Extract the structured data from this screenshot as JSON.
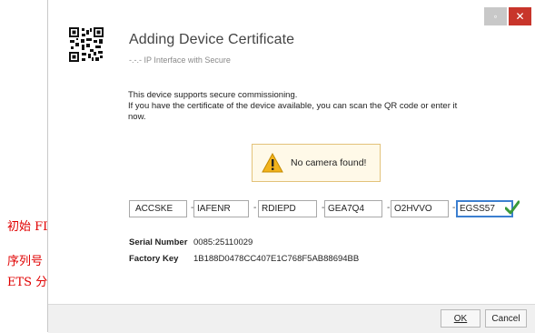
{
  "dialog": {
    "title": "Adding Device Certificate",
    "subtitle": "-.-.- IP Interface with Secure",
    "info_line1": "This device supports secure commissioning.",
    "info_line2": "If you have the certificate of the device available, you can scan the QR code or enter it",
    "info_line3": "now.",
    "warning_text": "No camera found!",
    "fdsk_fields": [
      "ACCSKE",
      "IAFENR",
      "RDIEPD",
      "GEA7Q4",
      "O2HVVO",
      "EGSS57"
    ],
    "serial_label": "Serial Number",
    "serial_value": "0085:25110029",
    "factory_label": "Factory Key",
    "factory_value": "1B188D0478CC407E1C768F5AB88694BB",
    "ok_label": "OK",
    "cancel_label": "Cancel"
  },
  "window_controls": {
    "min_icon": "minimize-icon",
    "close_icon": "close-icon"
  },
  "annotations": {
    "fdsk": "初始 FDSK",
    "serial": "序列号",
    "ets_key": "ETS 分配 Key"
  },
  "colors": {
    "accent": "#3c7fd0",
    "close": "#c8352b",
    "warning_bg": "#fff9e8",
    "check": "#3a9a3a",
    "annotation": "#e00000"
  }
}
